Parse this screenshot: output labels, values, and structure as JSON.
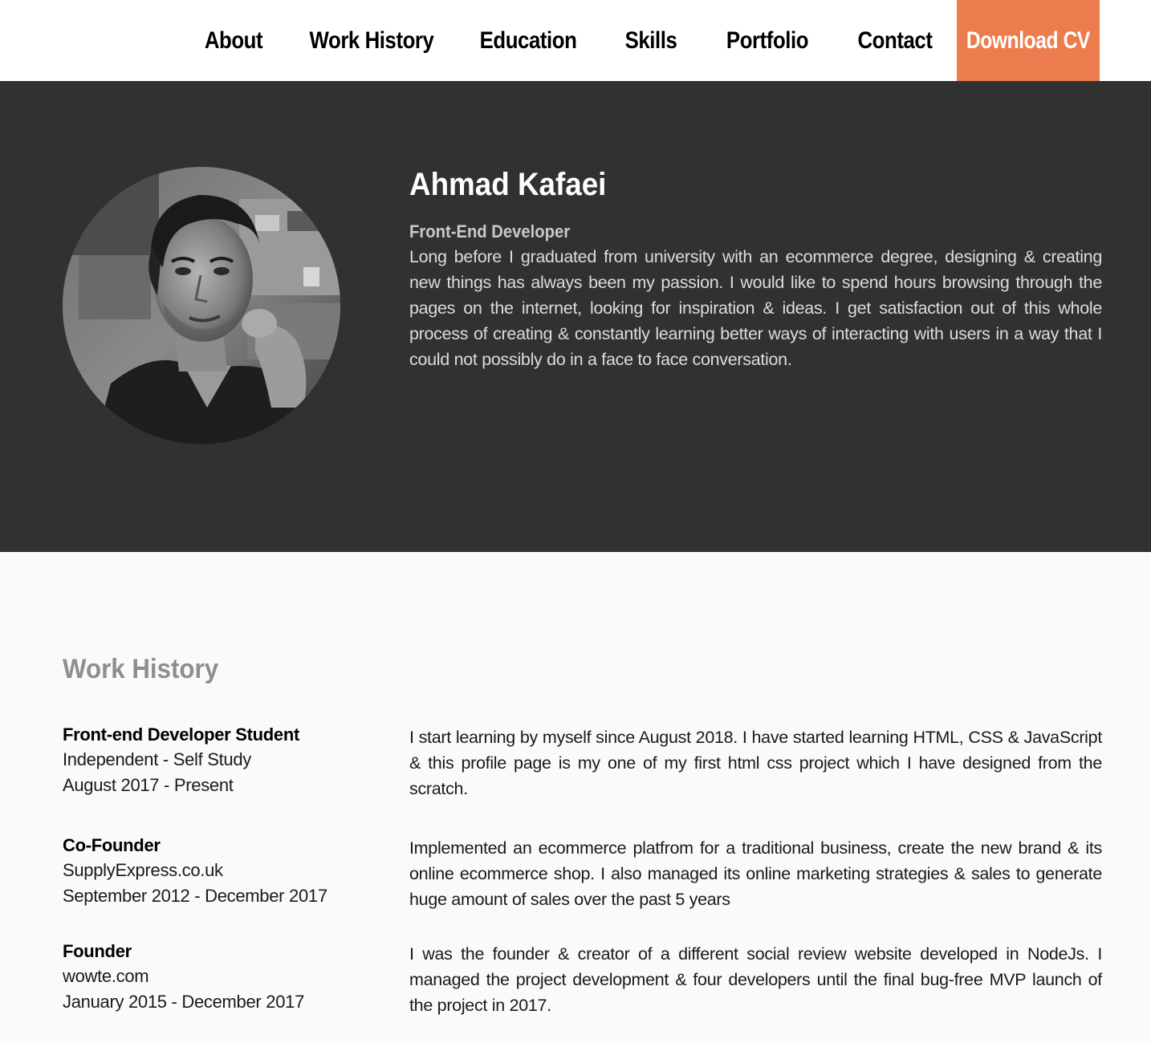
{
  "nav": {
    "items": [
      {
        "label": "About"
      },
      {
        "label": "Work History"
      },
      {
        "label": "Education"
      },
      {
        "label": "Skills"
      },
      {
        "label": "Portfolio"
      },
      {
        "label": "Contact"
      }
    ],
    "cta_label": "Download CV",
    "cta_color": "#ec7c4d"
  },
  "hero": {
    "name": "Ahmad Kafaei",
    "role": "Front-End Developer",
    "bio": "Long before I graduated from university with an ecommerce degree, designing & creating new things has always been my passion. I would like to spend hours browsing through the pages on the internet, looking for inspiration & ideas. I get satisfaction out of this whole process of creating & constantly learning better ways of interacting with users in a way that I could not possibly do in a face to face conversation.",
    "background_color": "#313131"
  },
  "work_history": {
    "title": "Work History",
    "jobs": [
      {
        "title": "Front-end Developer Student",
        "company": "Independent - Self Study",
        "period": "August 2017 - Present",
        "description": "I start learning by myself since August 2018. I have started learning HTML, CSS & JavaScript & this profile page is my one of my first html css project which I have designed from the scratch."
      },
      {
        "title": "Co-Founder",
        "company": "SupplyExpress.co.uk",
        "period": "September 2012 - December 2017",
        "description": "Implemented an ecommerce platfrom for a traditional business, create the new brand & its online ecommerce shop. I also managed its online marketing strategies & sales to generate huge amount of sales over the past 5 years"
      },
      {
        "title": "Founder",
        "company": "wowte.com",
        "period": "January 2015 - December 2017",
        "description": "I was the founder & creator of a different social review website developed in NodeJs. I managed the project development & four developers until the final bug-free MVP launch of the project in 2017."
      }
    ]
  }
}
